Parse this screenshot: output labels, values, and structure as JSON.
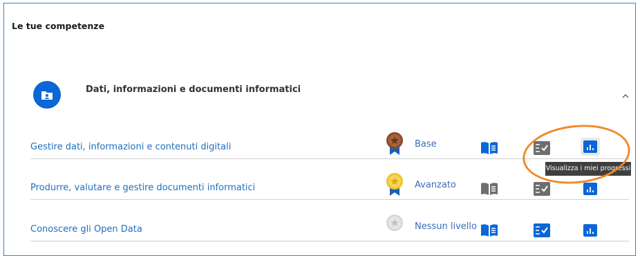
{
  "page": {
    "title": "Le tue competenze"
  },
  "area": {
    "title": "Dati, informazioni e documenti informatici",
    "icon": "folder-user-icon",
    "expanded": true
  },
  "competences": [
    {
      "label": "Gestire dati, informazioni e contenuti digitali",
      "level": "Base",
      "medal_color": "#8a4b2d",
      "book_active": true,
      "checklist_active": false,
      "progress_active": true
    },
    {
      "label": "Produrre, valutare e gestire documenti informatici",
      "level": "Avanzato",
      "medal_color": "#f0c22e",
      "book_active": false,
      "checklist_active": false,
      "progress_active": true
    },
    {
      "label": "Conoscere gli Open Data",
      "level": "Nessun livello",
      "medal_color": "#d7d7d7",
      "book_active": true,
      "checklist_active": true,
      "progress_active": true
    }
  ],
  "tooltip": {
    "text": "Visualizza i miei progressi"
  },
  "colors": {
    "accent": "#0b66d6",
    "link": "#1f6ebd",
    "inactive_icon": "#6e6e6e",
    "annotation": "#f08a2b"
  }
}
